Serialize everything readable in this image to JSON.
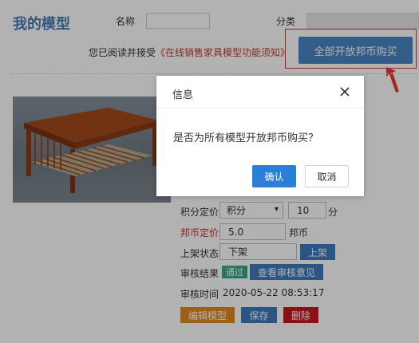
{
  "header": {
    "title": "我的模型",
    "name_label": "名称",
    "category_label": "分类",
    "name_value": "",
    "category_value": ""
  },
  "notice": {
    "text": "您已阅读并接受",
    "link": "《在线销售家具模型功能须知》"
  },
  "open_all_button": "全部开放邦币购买",
  "model": {
    "image_icon": "coffee-table-icon",
    "points_price_label": "积分定价",
    "points_select_value": "积分",
    "points_value": "10",
    "points_unit": "分",
    "bang_price_label": "邦币定价",
    "bang_price_value": "5.0",
    "bang_unit": "邦币",
    "listing_label": "上架状态",
    "listing_value": "下架",
    "listing_button": "上架",
    "review_label": "审核结果",
    "review_badge": "通过",
    "review_button": "查看审核意见",
    "review_time_label": "审核时间",
    "review_time_value": "2020-05-22 08:53:17",
    "edit_button": "编辑模型",
    "save_button": "保存",
    "delete_button": "删除"
  },
  "dialog": {
    "title": "信息",
    "message": "是否为所有模型开放邦币购买？",
    "confirm": "确认",
    "cancel": "取消"
  },
  "colors": {
    "accent": "#4a86c5",
    "confirm": "#2c7fd9",
    "edit": "#e08a1e",
    "save": "#3b7bbf",
    "delete": "#c9161d",
    "highlight": "#e03030",
    "pass": "#3ba58b"
  }
}
